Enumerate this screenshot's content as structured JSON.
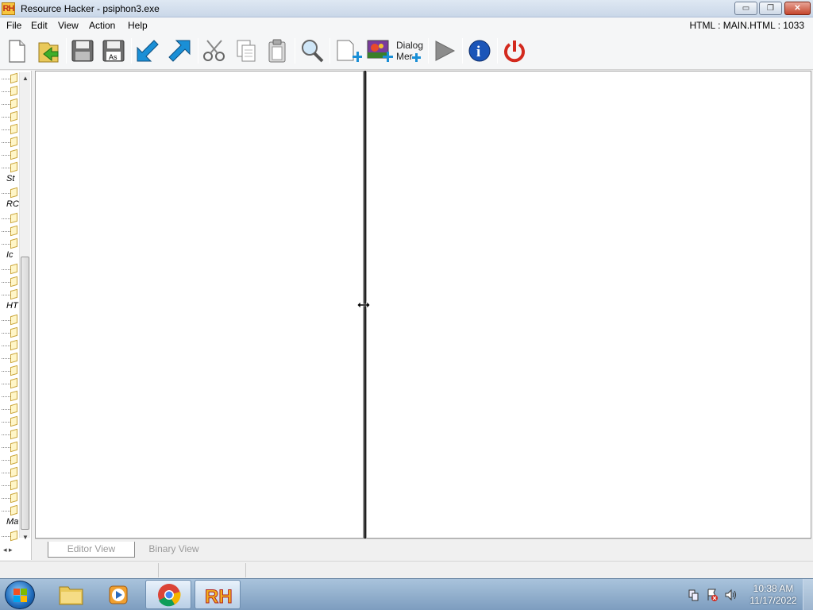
{
  "window": {
    "app_icon_text": "RH",
    "title": "Resource Hacker - psiphon3.exe",
    "minimize_glyph": "▭",
    "maximize_glyph": "❐",
    "close_glyph": "✕"
  },
  "menu": {
    "items": [
      "File",
      "Edit",
      "View",
      "Action",
      "Help"
    ],
    "resource_path": "HTML : MAIN.HTML : 1033"
  },
  "toolbar": {
    "buttons": [
      {
        "icon": "new-file-icon"
      },
      {
        "icon": "open-folder-icon"
      },
      {
        "icon": "save-icon"
      },
      {
        "icon": "save-as-icon",
        "text": "As"
      },
      {
        "icon": "arrow-down-left-icon"
      },
      {
        "icon": "arrow-up-right-icon"
      },
      {
        "icon": "cut-icon"
      },
      {
        "icon": "copy-icon"
      },
      {
        "icon": "paste-icon"
      },
      {
        "icon": "search-icon"
      },
      {
        "icon": "add-resource-icon"
      },
      {
        "icon": "add-image-icon"
      },
      {
        "icon": "dialog-menu-icon",
        "text_line1": "Dialog",
        "text_line2": "Mer"
      },
      {
        "icon": "play-icon"
      },
      {
        "icon": "info-icon",
        "text": "i"
      },
      {
        "icon": "power-icon"
      }
    ],
    "accent_blue": "#1a8fd6",
    "accent_red": "#d32a1e"
  },
  "tree": {
    "categories": [
      "St",
      "RC",
      "Ic",
      "HT",
      "Ma"
    ],
    "scroll_up": "▲",
    "scroll_down": "▼",
    "h_scroll": "◂ ▸"
  },
  "editor": {
    "tabs": {
      "editor": "Editor View",
      "binary": "Binary View"
    }
  },
  "taskbar": {
    "apps": [
      "start-button",
      "explorer-icon",
      "media-player-icon",
      "chrome-icon",
      "resource-hacker-icon"
    ],
    "rh_label": "RH",
    "time": "10:38 AM",
    "date": "11/17/2022"
  }
}
